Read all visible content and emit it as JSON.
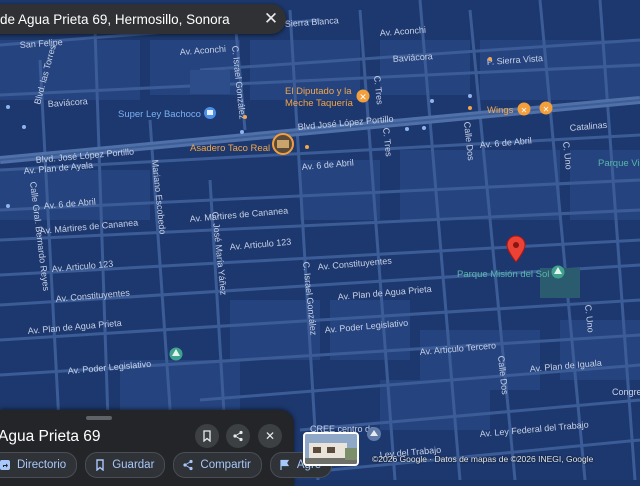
{
  "search": {
    "title": "de Agua Prieta 69, Hermosillo, Sonora"
  },
  "place": {
    "title": "Agua Prieta 69"
  },
  "actions": {
    "directions": "Directorio",
    "save": "Guardar",
    "share": "Compartir",
    "add": "Agre"
  },
  "attribution": "©2026 Google · Datos de mapas de ©2026 INEGI, Google",
  "streets": {
    "s1": "Sierra Blanca",
    "s2": "San Felipe",
    "s3": "Av. Aconchi",
    "s4": "Av. Aconchi",
    "s5": "Baviácora",
    "s6": "P. Sierra Vista",
    "s7": "Baviácora",
    "s8": "Blvd. José López Portillo",
    "s9": "Blvd José López Portillo",
    "s10": "Av. 6 de Abril",
    "s11": "Av. 6 de Abril",
    "s12": "Catalinas",
    "s13": "Av. Plan de Ayala",
    "s14": "Av. 6 de Abril",
    "s15": "Av. Martires de Cananea",
    "s16": "Av. Mártires de Cananea",
    "s17": "Av. Articulo 123",
    "s18": "Av. Articulo 123",
    "s19": "Av. Constituyentes",
    "s20": "Av. Constituyentes",
    "s21": "Av. Plan de Agua Prieta",
    "s22": "Av. Plan de Agua Prieta",
    "s23": "Av. Poder Legislativo",
    "s24": "Av. Poder Legislativo",
    "s25": "Av. Articulo Tercero",
    "s26": "Av. Plan de Iguala",
    "s27": "Av. Ley Federal del Trabajo",
    "s28": "Ley del Trabajo",
    "s29": "Blvd. las Torres",
    "s30": "Calle Gral. Bernardo Reyes",
    "s31": "Mariano Escobedo",
    "s32": "C. José María Yáñez",
    "s33": "C. Israel González",
    "s34": "C. Israel González",
    "s35": "C. Tres",
    "s36": "C. Tres",
    "s37": "Calle Dos",
    "s38": "Calle Dos",
    "s39": "C. Uno",
    "s40": "C. Uno",
    "s41": "Congre",
    "s42": "CREE centro de"
  },
  "pois": {
    "superley": "Super Ley Bachoco",
    "diputado1": "El Diputado y la",
    "diputado2": "Meche Taquería",
    "taco": "Asadero Taco Real",
    "wings": "Wings",
    "parquev": "Parque Vic",
    "parquemision": "Parque Misión del Sol"
  },
  "colors": {
    "water": "#1b3468",
    "block": "#26447f",
    "road": "#3b5c97",
    "road_major": "#4f70a9",
    "accent": "#a8c7fa",
    "pin": "#ea4335"
  }
}
